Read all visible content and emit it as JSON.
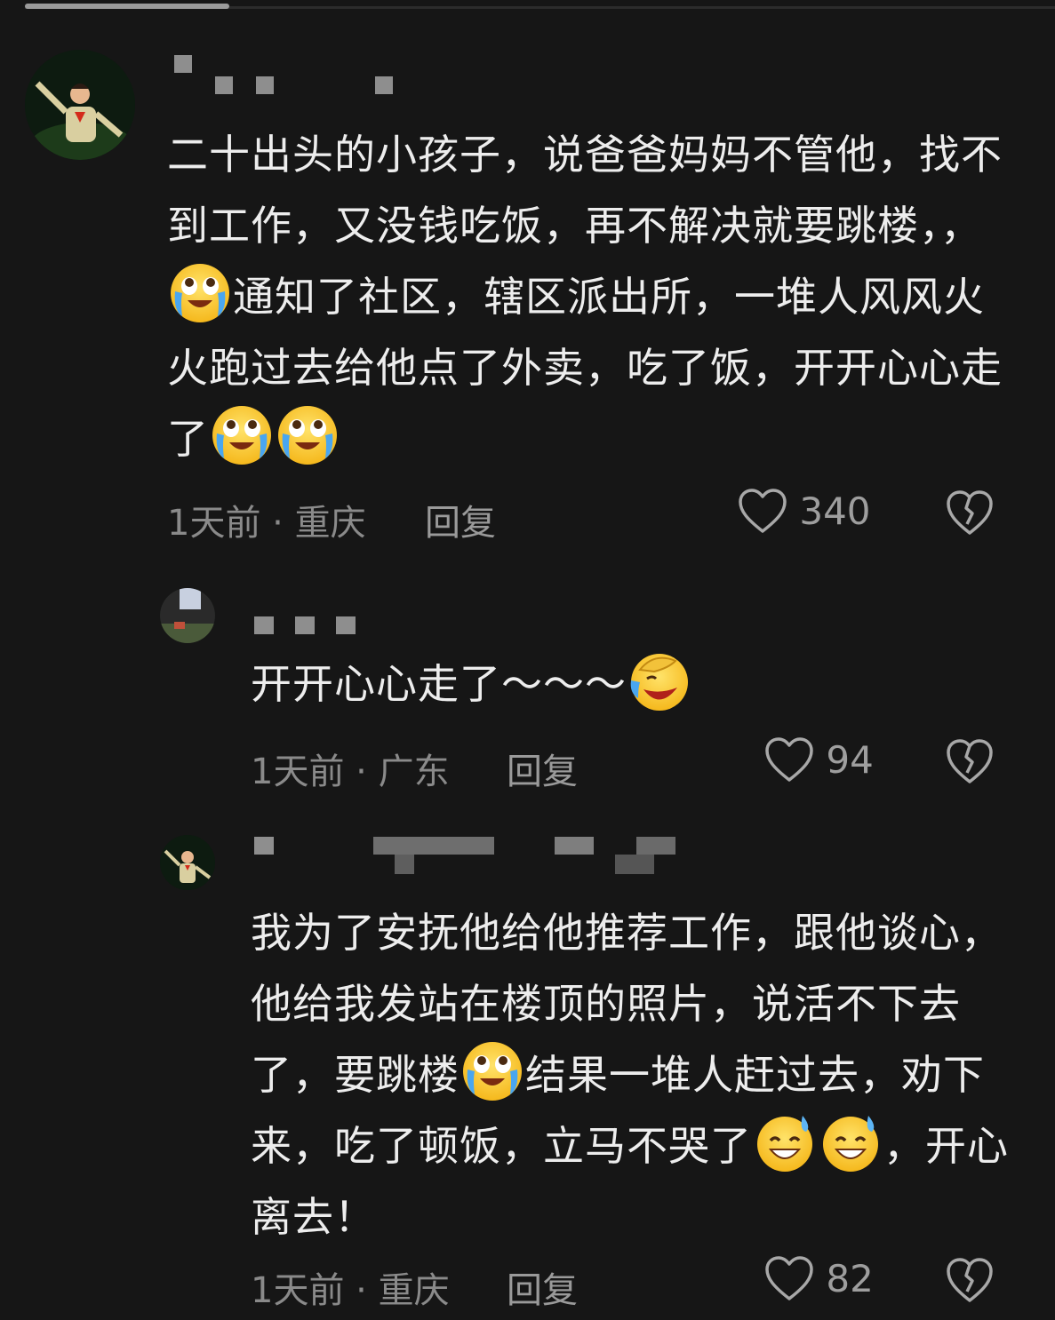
{
  "comments": [
    {
      "text_parts": [
        "二十出头的小孩子，说爸爸妈妈不管他，找不到工作，又没钱吃饭，再不解决就要跳楼，，",
        "通知了社区，辖区派出所，一堆人风风火火跑过去给他点了外卖，吃了饭，开开心心走了"
      ],
      "emojis": [
        "crying-emoji",
        "crying-emoji",
        "crying-emoji"
      ],
      "time_location": "1天前 · 重庆",
      "reply_label": "回复",
      "likes": "340"
    },
    {
      "text": "开开心心走了～～～",
      "emojis": [
        "laughing-tears-emoji"
      ],
      "time_location": "1天前 · 广东",
      "reply_label": "回复",
      "likes": "94"
    },
    {
      "text_parts": [
        "我为了安抚他给他推荐工作，跟他谈心，他给我发站在楼顶的照片，说活不下去了，要跳楼",
        "结果一堆人赶过去，劝下来，吃了顿饭，立马不哭了",
        "，开心离去！"
      ],
      "emojis": [
        "crying-emoji",
        "sweat-smile-emoji",
        "sweat-smile-emoji"
      ],
      "time_location": "1天前 · 重庆",
      "reply_label": "回复",
      "likes": "82"
    }
  ]
}
